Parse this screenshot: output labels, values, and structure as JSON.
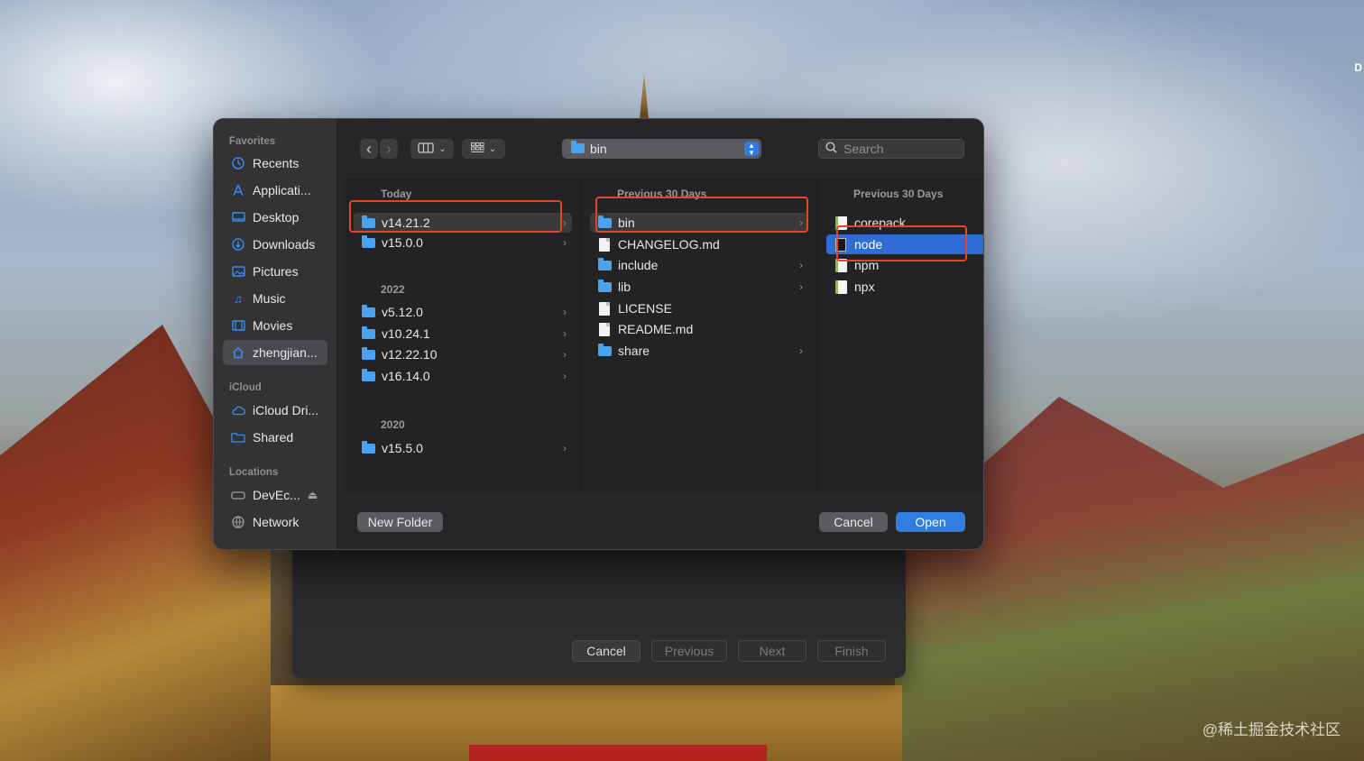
{
  "desktop": {
    "corner_letter": "D",
    "watermark": "@稀土掘金技术社区"
  },
  "wizard": {
    "buttons": [
      "Cancel",
      "Previous",
      "Next",
      "Finish"
    ]
  },
  "sidebar": {
    "sections": {
      "favorites": "Favorites",
      "icloud": "iCloud",
      "locations": "Locations"
    },
    "favorites": [
      {
        "label": "Recents",
        "icon": "clock-icon"
      },
      {
        "label": "Applicati...",
        "icon": "applications-icon"
      },
      {
        "label": "Desktop",
        "icon": "desktop-icon"
      },
      {
        "label": "Downloads",
        "icon": "download-icon"
      },
      {
        "label": "Pictures",
        "icon": "pictures-icon"
      },
      {
        "label": "Music",
        "icon": "music-icon"
      },
      {
        "label": "Movies",
        "icon": "movies-icon"
      },
      {
        "label": "zhengjian...",
        "icon": "home-icon"
      }
    ],
    "icloud": [
      {
        "label": "iCloud Dri...",
        "icon": "cloud-icon"
      },
      {
        "label": "Shared",
        "icon": "shared-folder-icon"
      }
    ],
    "locations": [
      {
        "label": "DevEc...",
        "icon": "drive-icon",
        "eject": "⏏"
      },
      {
        "label": "Network",
        "icon": "network-icon"
      }
    ]
  },
  "toolbar": {
    "back": "‹",
    "forward": "›",
    "path": "bin",
    "search_placeholder": "Search"
  },
  "columns": {
    "col1": {
      "groups": [
        {
          "header": "Today",
          "items": [
            "v14.21.2",
            "v15.0.0"
          ]
        },
        {
          "header": "2022",
          "items": [
            "v5.12.0",
            "v10.24.1",
            "v12.22.10",
            "v16.14.0"
          ]
        },
        {
          "header": "2020",
          "items": [
            "v15.5.0"
          ]
        }
      ]
    },
    "col2": {
      "header": "Previous 30 Days",
      "items": [
        {
          "label": "bin",
          "type": "folder"
        },
        {
          "label": "CHANGELOG.md",
          "type": "doc"
        },
        {
          "label": "include",
          "type": "folder"
        },
        {
          "label": "lib",
          "type": "folder"
        },
        {
          "label": "LICENSE",
          "type": "doc"
        },
        {
          "label": "README.md",
          "type": "doc"
        },
        {
          "label": "share",
          "type": "folder"
        }
      ]
    },
    "col3": {
      "header": "Previous 30 Days",
      "items": [
        {
          "label": "corepack",
          "type": "exec"
        },
        {
          "label": "node",
          "type": "binary"
        },
        {
          "label": "npm",
          "type": "exec"
        },
        {
          "label": "npx",
          "type": "exec"
        }
      ]
    }
  },
  "footer": {
    "new_folder": "New Folder",
    "cancel": "Cancel",
    "open": "Open"
  },
  "colors": {
    "accent": "#2f7de0",
    "highlight": "#e0452e"
  }
}
